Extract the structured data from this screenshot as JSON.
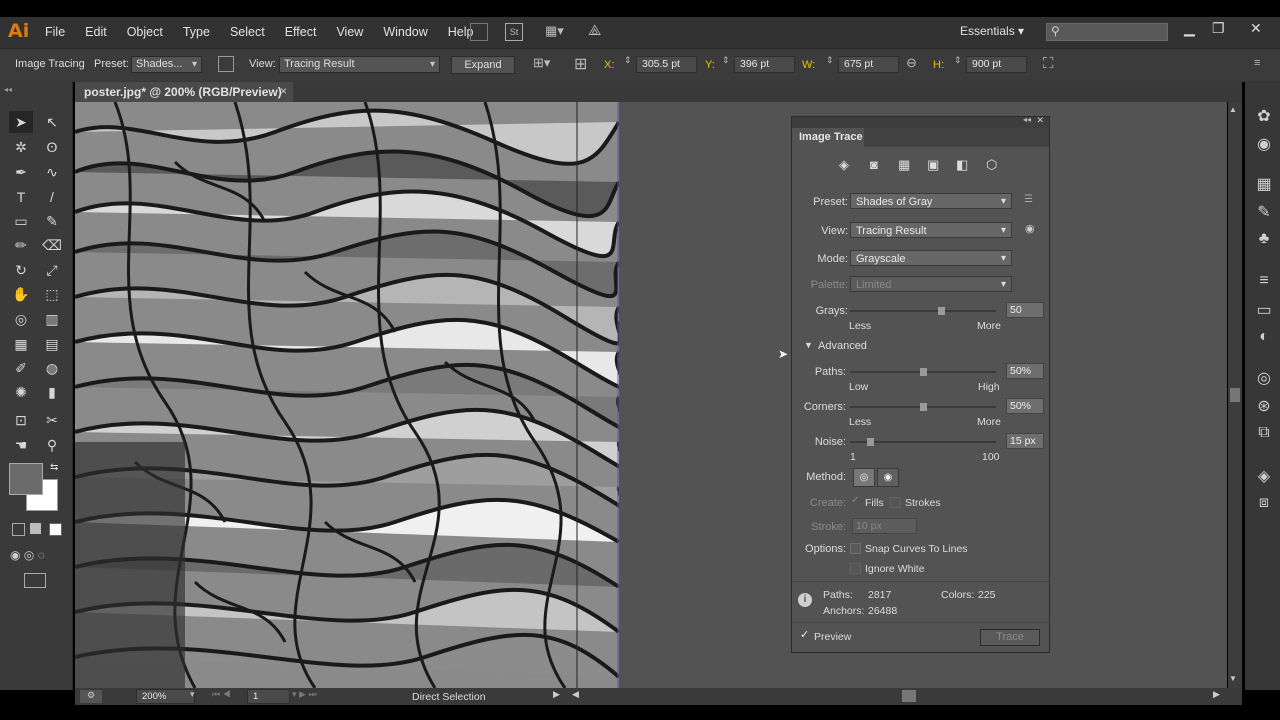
{
  "app": {
    "logo": "Ai"
  },
  "menu": [
    "File",
    "Edit",
    "Object",
    "Type",
    "Select",
    "Effect",
    "View",
    "Window",
    "Help"
  ],
  "workspace": {
    "label": "Essentials"
  },
  "control_bar": {
    "mode_label": "Image Tracing",
    "preset_label": "Preset:",
    "preset_value": "Shades...",
    "view_label": "View:",
    "view_value": "Tracing Result",
    "expand_button": "Expand",
    "x_label": "X:",
    "x_value": "305.5 pt",
    "y_label": "Y:",
    "y_value": "396 pt",
    "w_label": "W:",
    "w_value": "675 pt",
    "h_label": "H:",
    "h_value": "900 pt"
  },
  "document": {
    "tab_title": "poster.jpg* @ 200% (RGB/Preview)",
    "close": "×"
  },
  "status": {
    "zoom": "200%",
    "page": "1",
    "tool": "Direct Selection"
  },
  "image_trace": {
    "title": "Image Trace",
    "preset_label": "Preset:",
    "preset_value": "Shades of Gray",
    "view_label": "View:",
    "view_value": "Tracing Result",
    "mode_label": "Mode:",
    "mode_value": "Grayscale",
    "palette_label": "Palette:",
    "palette_value": "Limited",
    "grays_label": "Grays:",
    "grays_value": "50",
    "grays_min": "Less",
    "grays_max": "More",
    "grays_level": 0.62,
    "advanced_label": "Advanced",
    "paths_label": "Paths:",
    "paths_value": "50%",
    "paths_min": "Low",
    "paths_max": "High",
    "paths_level": 0.5,
    "corners_label": "Corners:",
    "corners_value": "50%",
    "corners_min": "Less",
    "corners_max": "More",
    "corners_level": 0.5,
    "noise_label": "Noise:",
    "noise_value": "15 px",
    "noise_min": "1",
    "noise_max": "100",
    "noise_level": 0.14,
    "method_label": "Method:",
    "create_label": "Create:",
    "fills_label": "Fills",
    "strokes_label": "Strokes",
    "stroke_label": "Stroke:",
    "stroke_value": "10 px",
    "options_label": "Options:",
    "snap_label": "Snap Curves To Lines",
    "ignore_white_label": "Ignore White",
    "stats_paths_label": "Paths:",
    "stats_paths_value": "2817",
    "stats_colors_label": "Colors:",
    "stats_colors_value": "225",
    "stats_anchors_label": "Anchors:",
    "stats_anchors_value": "26488",
    "preview_label": "Preview",
    "trace_button": "Trace"
  },
  "colors": {
    "accent": "#e07a10",
    "panel": "#535353",
    "chrome": "#323232"
  }
}
